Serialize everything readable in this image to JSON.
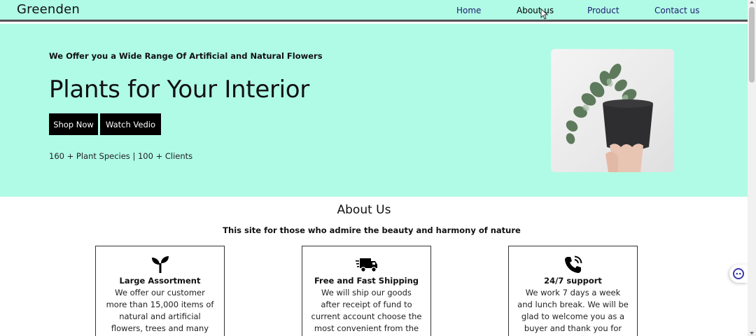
{
  "header": {
    "brand": "Greenden",
    "nav": [
      {
        "label": "Home"
      },
      {
        "label": "About us"
      },
      {
        "label": "Product"
      },
      {
        "label": "Contact us"
      }
    ]
  },
  "hero": {
    "tagline": "We Offer you a Wide Range Of Artificial and Natural Flowers",
    "title": "Plants for Your Interior",
    "buttons": {
      "shop_now": "Shop Now",
      "watch_video": "Watch Vedio"
    },
    "stats": "160 + Plant Species | 100 + Clients"
  },
  "about": {
    "title": "About Us",
    "subtitle": "This site for those who admire the beauty and harmony of nature",
    "cards": [
      {
        "icon": "seedling-icon",
        "title": "Large Assortment",
        "text": "We offer our customer more than 15,000 items of natural and artificial flowers, trees and many"
      },
      {
        "icon": "shipping-truck-icon",
        "title": "Free and Fast Shipping",
        "text": "We will ship our goods after receipt of fund to current account choose the most convenient from the offer"
      },
      {
        "icon": "phone-call-icon",
        "title": "24/7 support",
        "text": "We work 7 days a week and lunch break. We will be glad to welcome you as a buyer and thank you for"
      }
    ]
  },
  "colors": {
    "hero_background": "#b0fbe6",
    "nav_link": "#1d1a6e",
    "button_background": "#000000"
  }
}
